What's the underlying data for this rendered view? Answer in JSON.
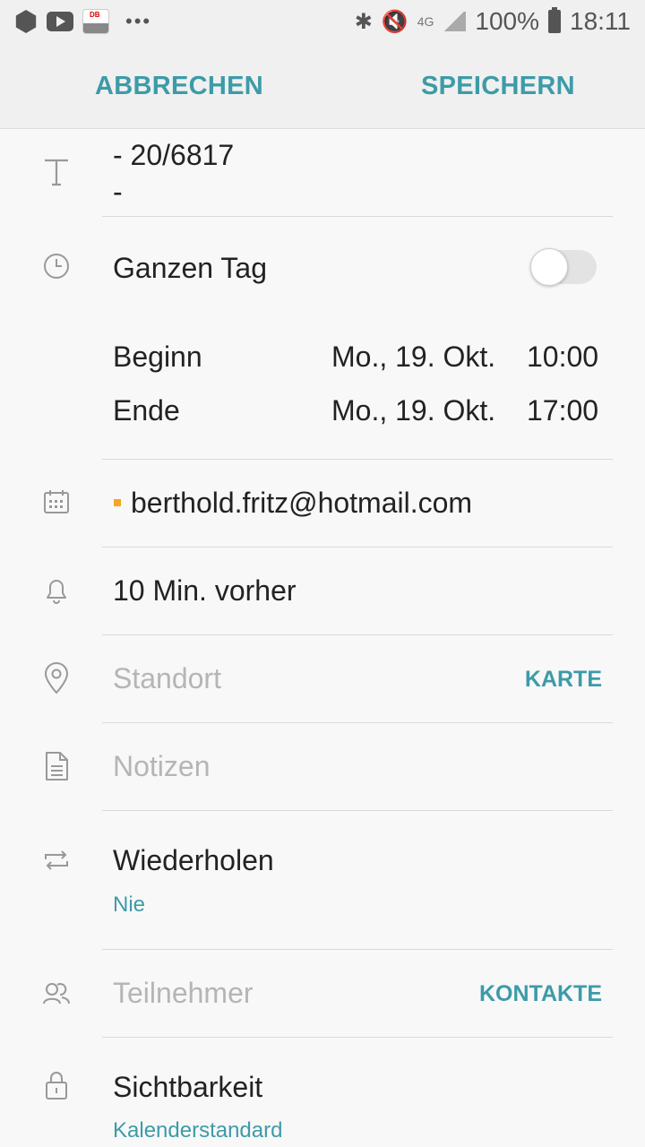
{
  "status": {
    "battery": "100%",
    "time": "18:11",
    "network": "4G"
  },
  "actionbar": {
    "cancel": "ABBRECHEN",
    "save": "SPEICHERN"
  },
  "title": {
    "line1": "-  20/6817",
    "line2": "-"
  },
  "allday": {
    "label": "Ganzen Tag",
    "on": false
  },
  "start": {
    "label": "Beginn",
    "date": "Mo., 19. Okt.",
    "time": "10:00"
  },
  "end": {
    "label": "Ende",
    "date": "Mo., 19. Okt.",
    "time": "17:00"
  },
  "calendar": {
    "account": "berthold.fritz@hotmail.com",
    "color": "#f6a623"
  },
  "reminder": {
    "value": "10 Min. vorher"
  },
  "location": {
    "placeholder": "Standort",
    "action": "KARTE"
  },
  "notes": {
    "placeholder": "Notizen"
  },
  "repeat": {
    "label": "Wiederholen",
    "value": "Nie"
  },
  "participants": {
    "placeholder": "Teilnehmer",
    "action": "KONTAKTE"
  },
  "visibility": {
    "label": "Sichtbarkeit",
    "value": "Kalenderstandard"
  },
  "colors": {
    "accent": "#3d9ba8",
    "hint": "#b5b5b5"
  }
}
